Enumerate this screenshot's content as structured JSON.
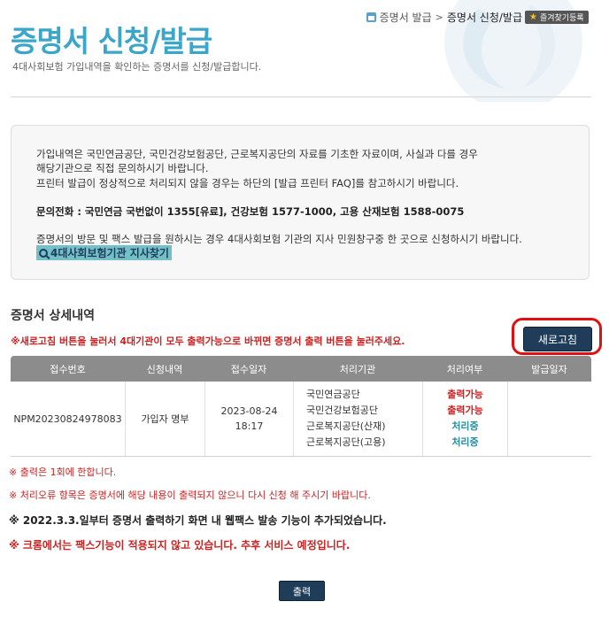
{
  "header": {
    "breadcrumb": [
      "증명서 발급",
      "증명서 신청/발급"
    ],
    "breadcrumb_sep": ">",
    "favorite_label": "즐겨찾기등록",
    "title": "증명서 신청/발급",
    "description": "4대사회보험 가입내역을 확인하는 증명서를 신청/발급합니다."
  },
  "notice": {
    "lines": [
      "가입내역은 국민연금공단, 국민건강보험공단, 근로복지공단의 자료를 기초한 자료이며, 사실과 다를 경우",
      "해당기관으로 직접 문의하시기 바랍니다.",
      "프린터 발급이 정상적으로 처리되지 않을 경우는 하단의 [발급 프린터 FAQ]를 참고하시기 바랍니다."
    ],
    "phone": "문의전화 : 국민연금 국번없이 1355[유료], 건강보험 1577-1000, 고용 산재보험 1588-0075",
    "visit": "증명서의 방문 및 팩스 발급을 원하시는 경우 4대사회보험 기관의 지사 민원창구중 한 곳으로 신청하시기 바랍니다.",
    "branch_link": "4대사회보험기관 지사찾기"
  },
  "detail": {
    "title": "증명서 상세내역",
    "refresh_note": "※새로고침 버튼을 눌러서 4대기관이 모두 출력가능으로 바뀌면 증명서 출력 버튼을 눌러주세요.",
    "refresh_label": "새로고침",
    "columns": [
      "접수번호",
      "신청내역",
      "접수일자",
      "처리기관",
      "처리여부",
      "발급일자"
    ],
    "row": {
      "receipt_no": "NPM20230824978083",
      "request": "가입자 명부",
      "date": "2023-08-24",
      "time": "18:17",
      "orgs": [
        "국민연금공단",
        "국민건강보험공단",
        "근로복지공단(산재)",
        "근로복지공단(고용)"
      ],
      "statuses": [
        "출력가능",
        "출력가능",
        "처리중",
        "처리중"
      ],
      "issue_date": ""
    }
  },
  "footnotes": [
    "※ 출력은 1회에 한합니다.",
    "※ 처리오류 항목은 증명서에 해당 내용이 출력되지 않으니 다시 신청 해 주시기 바랍니다.",
    "※ 2022.3.3.일부터 증명서 출력하기 화면 내 웹팩스 발송 기능이 추가되었습니다.",
    "※ 크롬에서는 팩스기능이 적용되지 않고 있습니다. 추후 서비스 예정입니다."
  ],
  "print_label": "출력",
  "colors": {
    "title": "#3aa6c9",
    "button": "#1f3d59",
    "alert": "#cc2222",
    "highlight": "#e01010"
  }
}
